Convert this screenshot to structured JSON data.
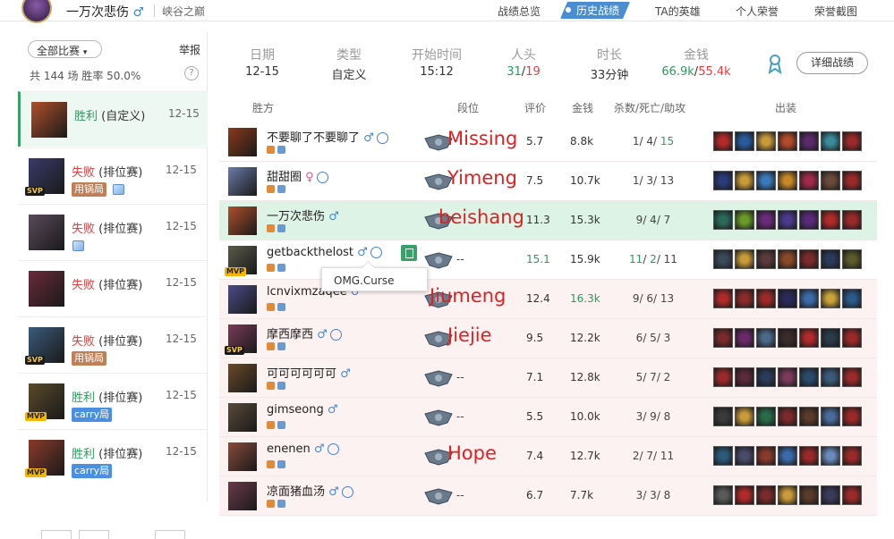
{
  "header": {
    "user_name": "一万次悲伤",
    "gender_glyph": "♂",
    "server": "峡谷之巅",
    "nav": [
      "战绩总览",
      "历史战绩",
      "TA的英雄",
      "个人荣誉",
      "荣誉截图"
    ],
    "active_nav": "历史战绩"
  },
  "sidebar": {
    "filter_label": "全部比赛",
    "report_label": "举报",
    "stats_text": "共 144 场   胜率 50.0%",
    "help_glyph": "?",
    "matches": [
      {
        "result": "胜利",
        "mode": "(自定义)",
        "date": "12-15",
        "selected": true,
        "result_type": "win",
        "badge": "",
        "tag": "",
        "image_icon": false,
        "champ_color": "#b0502a"
      },
      {
        "result": "失败",
        "mode": "(排位赛)",
        "date": "12-15",
        "selected": false,
        "result_type": "loss",
        "badge": "SVP",
        "tag": "用锅局",
        "tag_color": "brown",
        "image_icon": true,
        "champ_color": "#3a3a6a"
      },
      {
        "result": "失败",
        "mode": "(排位赛)",
        "date": "12-15",
        "selected": false,
        "result_type": "loss",
        "badge": "",
        "tag": "",
        "image_icon": true,
        "champ_color": "#5a4a5a"
      },
      {
        "result": "失败",
        "mode": "(排位赛)",
        "date": "12-15",
        "selected": false,
        "result_type": "loss",
        "badge": "",
        "tag": "",
        "image_icon": false,
        "champ_color": "#6a2a3a"
      },
      {
        "result": "失败",
        "mode": "(排位赛)",
        "date": "12-15",
        "selected": false,
        "result_type": "loss",
        "badge": "SVP",
        "tag": "用锅局",
        "tag_color": "brown",
        "image_icon": false,
        "champ_color": "#3a5a7a"
      },
      {
        "result": "胜利",
        "mode": "(排位赛)",
        "date": "12-15",
        "selected": false,
        "result_type": "win",
        "badge": "MVP",
        "tag": "carry局",
        "tag_color": "blue",
        "image_icon": false,
        "champ_color": "#5a4a2a"
      },
      {
        "result": "胜利",
        "mode": "(排位赛)",
        "date": "12-15",
        "selected": false,
        "result_type": "win",
        "badge": "MVP",
        "tag": "carry局",
        "tag_color": "blue",
        "image_icon": false,
        "champ_color": "#8a3a2a"
      }
    ]
  },
  "summary": {
    "labels": [
      "日期",
      "类型",
      "开始时间",
      "人头",
      "时长",
      "金钱"
    ],
    "date": "12-15",
    "type": "自定义",
    "start_time": "15:12",
    "kills_blue": "31",
    "kills_sep": "/",
    "kills_red": "19",
    "duration": "33分钟",
    "gold_blue": "66.9k",
    "gold_sep": "/",
    "gold_red": "55.4k",
    "detail_button": "详细战绩"
  },
  "table": {
    "headers": [
      "胜方",
      "段位",
      "评价",
      "金钱",
      "杀数/死亡/助攻",
      "出装"
    ],
    "rows": [
      {
        "name": "不要聊了不要聊了",
        "rank": "",
        "score": "5.7",
        "gold": "8.8k",
        "k": "1",
        "d": "4",
        "a": "15",
        "a_green": true,
        "score_green": false,
        "gold_green": false,
        "k_green": false,
        "d_green": false,
        "type": "win",
        "overlay": "Missing",
        "champ": "#8a3a1a",
        "agent": true,
        "badge": "",
        "items": [
          "#b02a2a",
          "#2a5a9a",
          "#c89a3a",
          "#b04a2a",
          "#5a2a6a",
          "#3a8a9a",
          "#9a2a2a"
        ]
      },
      {
        "name": "甜甜圈",
        "gender": "♀",
        "rank": "",
        "score": "7.5",
        "gold": "10.7k",
        "k": "1",
        "d": "3",
        "a": "13",
        "a_green": false,
        "score_green": false,
        "gold_green": false,
        "k_green": false,
        "d_green": false,
        "type": "win",
        "overlay": "Yimeng",
        "champ": "#6a7aaa",
        "agent": true,
        "badge": "",
        "items": [
          "#2a3a7a",
          "#c89a3a",
          "#3a7aba",
          "#c8882a",
          "#a02a4a",
          "#6a4a3a",
          "#9a2a2a"
        ]
      },
      {
        "name": "一万次悲伤",
        "rank": "",
        "score": "11.3",
        "gold": "15.3k",
        "k": "9",
        "d": "4",
        "a": "7",
        "a_green": false,
        "score_green": false,
        "gold_green": false,
        "k_green": false,
        "d_green": false,
        "type": "self",
        "overlay": "beishang",
        "champ": "#b0502a",
        "agent": false,
        "badge": "",
        "items": [
          "#2a6a5a",
          "#6a9a2a",
          "#6a2a7a",
          "#4a3a8a",
          "#5a2a7a",
          "#b02a2a",
          "#9a2a2a"
        ]
      },
      {
        "name": "getbackthelost",
        "rank": "--",
        "score": "15.1",
        "gold": "15.9k",
        "k": "11",
        "d": "2",
        "a": "11",
        "a_green": false,
        "score_green": true,
        "gold_green": false,
        "k_green": true,
        "d_green": true,
        "type": "win",
        "overlay": "",
        "champ": "#5a5a4a",
        "agent": true,
        "badge": "MVP",
        "items": [
          "#3a4a5a",
          "#c89a3a",
          "#5a3a3a",
          "#8a4a2a",
          "#7a2a2a",
          "#2a3a5a",
          "#5a5a2a"
        ]
      },
      {
        "name": "lcnvixmzaqee",
        "rank": "",
        "score": "12.4",
        "gold": "16.3k",
        "k": "9",
        "d": "6",
        "a": "13",
        "a_green": false,
        "score_green": false,
        "gold_green": true,
        "k_green": false,
        "d_green": false,
        "type": "lose",
        "overlay": "Jiumeng",
        "champ": "#4a4a8a",
        "agent": false,
        "badge": "",
        "items": [
          "#b02a2a",
          "#8a2a2a",
          "#9a2a2a",
          "#2a2a5a",
          "#3a6aaa",
          "#c8a23a",
          "#2a5a8a"
        ]
      },
      {
        "name": "摩西摩西",
        "rank": "",
        "score": "9.5",
        "gold": "12.2k",
        "k": "6",
        "d": "5",
        "a": "3",
        "a_green": false,
        "score_green": false,
        "gold_green": false,
        "k_green": false,
        "d_green": false,
        "type": "lose",
        "overlay": "Jiejie",
        "champ": "#7a3a5a",
        "agent": true,
        "badge": "SVP",
        "items": [
          "#7a2a2a",
          "#6a2a6a",
          "#4a6a8a",
          "#3a2a2a",
          "#b02a2a",
          "#2a3a4a",
          "#9a2a2a"
        ]
      },
      {
        "name": "可可可可可可",
        "rank": "--",
        "score": "7.1",
        "gold": "12.8k",
        "k": "5",
        "d": "7",
        "a": "2",
        "a_green": false,
        "score_green": false,
        "gold_green": false,
        "k_green": false,
        "d_green": false,
        "type": "lose",
        "overlay": "",
        "champ": "#6a4a2a",
        "agent": false,
        "badge": "",
        "items": [
          "#9a2a2a",
          "#5a2a3a",
          "#2a3a5a",
          "#7a3a5a",
          "#2a4a6a",
          "#3a5a7a",
          "#9a2a2a"
        ]
      },
      {
        "name": "gimseong",
        "rank": "--",
        "score": "5.5",
        "gold": "10.0k",
        "k": "3",
        "d": "9",
        "a": "8",
        "a_green": false,
        "score_green": false,
        "gold_green": false,
        "k_green": false,
        "d_green": false,
        "type": "lose",
        "overlay": "",
        "champ": "#5a4a3a",
        "agent": false,
        "badge": "",
        "items": [
          "#3a3a3a",
          "#c89a3a",
          "#2a6a4a",
          "#7a2a2a",
          "#5a3a2a",
          "#4a6a9a",
          "#9a2a2a"
        ]
      },
      {
        "name": "enenen",
        "rank": "",
        "score": "7.4",
        "gold": "12.7k",
        "k": "2",
        "d": "7",
        "a": "11",
        "a_green": false,
        "score_green": false,
        "gold_green": false,
        "k_green": false,
        "d_green": false,
        "type": "lose",
        "overlay": "Hope",
        "champ": "#8a4a3a",
        "agent": true,
        "badge": "",
        "items": [
          "#2a5a7a",
          "#4a4a6a",
          "#8a3a2a",
          "#3a6aaa",
          "#9a2a2a",
          "#6a8aba",
          "#9a2a2a"
        ]
      },
      {
        "name": "凉面猪血汤",
        "rank": "--",
        "score": "6.7",
        "gold": "7.7k",
        "k": "3",
        "d": "3",
        "a": "8",
        "a_green": false,
        "score_green": false,
        "gold_green": false,
        "k_green": false,
        "d_green": false,
        "type": "lose",
        "overlay": "",
        "champ": "#6a3a4a",
        "agent": true,
        "badge": "",
        "items": [
          "#5a5a5a",
          "#b02a2a",
          "#7a2a2a",
          "#c89a3a",
          "#5a3a2a",
          "#3a3a5a",
          "#9a2a2a"
        ]
      }
    ]
  },
  "tooltip": "OMG.Curse",
  "colors": {
    "win": "#2c9a5c",
    "loss": "#e04040",
    "accent": "#4a8dd0",
    "overlay": "#e02020"
  }
}
